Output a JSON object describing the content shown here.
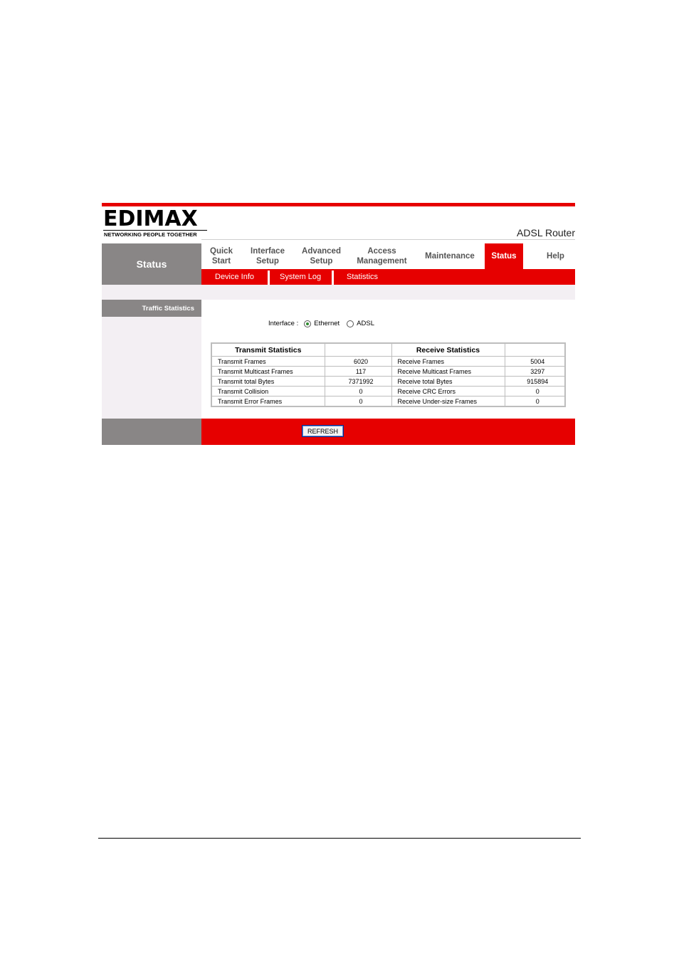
{
  "brand": {
    "logo_word": "EDIMAX",
    "tagline": "NETWORKING PEOPLE TOGETHER",
    "product": "ADSL Router"
  },
  "section_title": "Status",
  "nav": [
    {
      "label": "Quick\nStart",
      "active": false
    },
    {
      "label": "Interface\nSetup",
      "active": false
    },
    {
      "label": "Advanced\nSetup",
      "active": false
    },
    {
      "label": "Access\nManagement",
      "active": false
    },
    {
      "label": "Maintenance",
      "active": false
    },
    {
      "label": "Status",
      "active": true
    },
    {
      "label": "Help",
      "active": false
    }
  ],
  "subnav": [
    "Device Info",
    "System Log",
    "Statistics"
  ],
  "sidebar_label": "Traffic Statistics",
  "interface": {
    "label": "Interface :",
    "options": [
      {
        "label": "Ethernet",
        "selected": true
      },
      {
        "label": "ADSL",
        "selected": false
      }
    ]
  },
  "stats": {
    "transmit_header": "Transmit Statistics",
    "receive_header": "Receive Statistics",
    "rows": [
      {
        "tx_label": "Transmit Frames",
        "tx_value": "6020",
        "rx_label": "Receive Frames",
        "rx_value": "5004"
      },
      {
        "tx_label": "Transmit Multicast Frames",
        "tx_value": "117",
        "rx_label": "Receive Multicast Frames",
        "rx_value": "3297"
      },
      {
        "tx_label": "Transmit total Bytes",
        "tx_value": "7371992",
        "rx_label": "Receive total Bytes",
        "rx_value": "915894"
      },
      {
        "tx_label": "Transmit Collision",
        "tx_value": "0",
        "rx_label": "Receive CRC Errors",
        "rx_value": "0"
      },
      {
        "tx_label": "Transmit Error Frames",
        "tx_value": "0",
        "rx_label": "Receive Under-size Frames",
        "rx_value": "0"
      }
    ]
  },
  "refresh_label": "REFRESH",
  "colors": {
    "accent": "#e60000",
    "sidebar": "#898686",
    "band": "#f3eff3"
  }
}
